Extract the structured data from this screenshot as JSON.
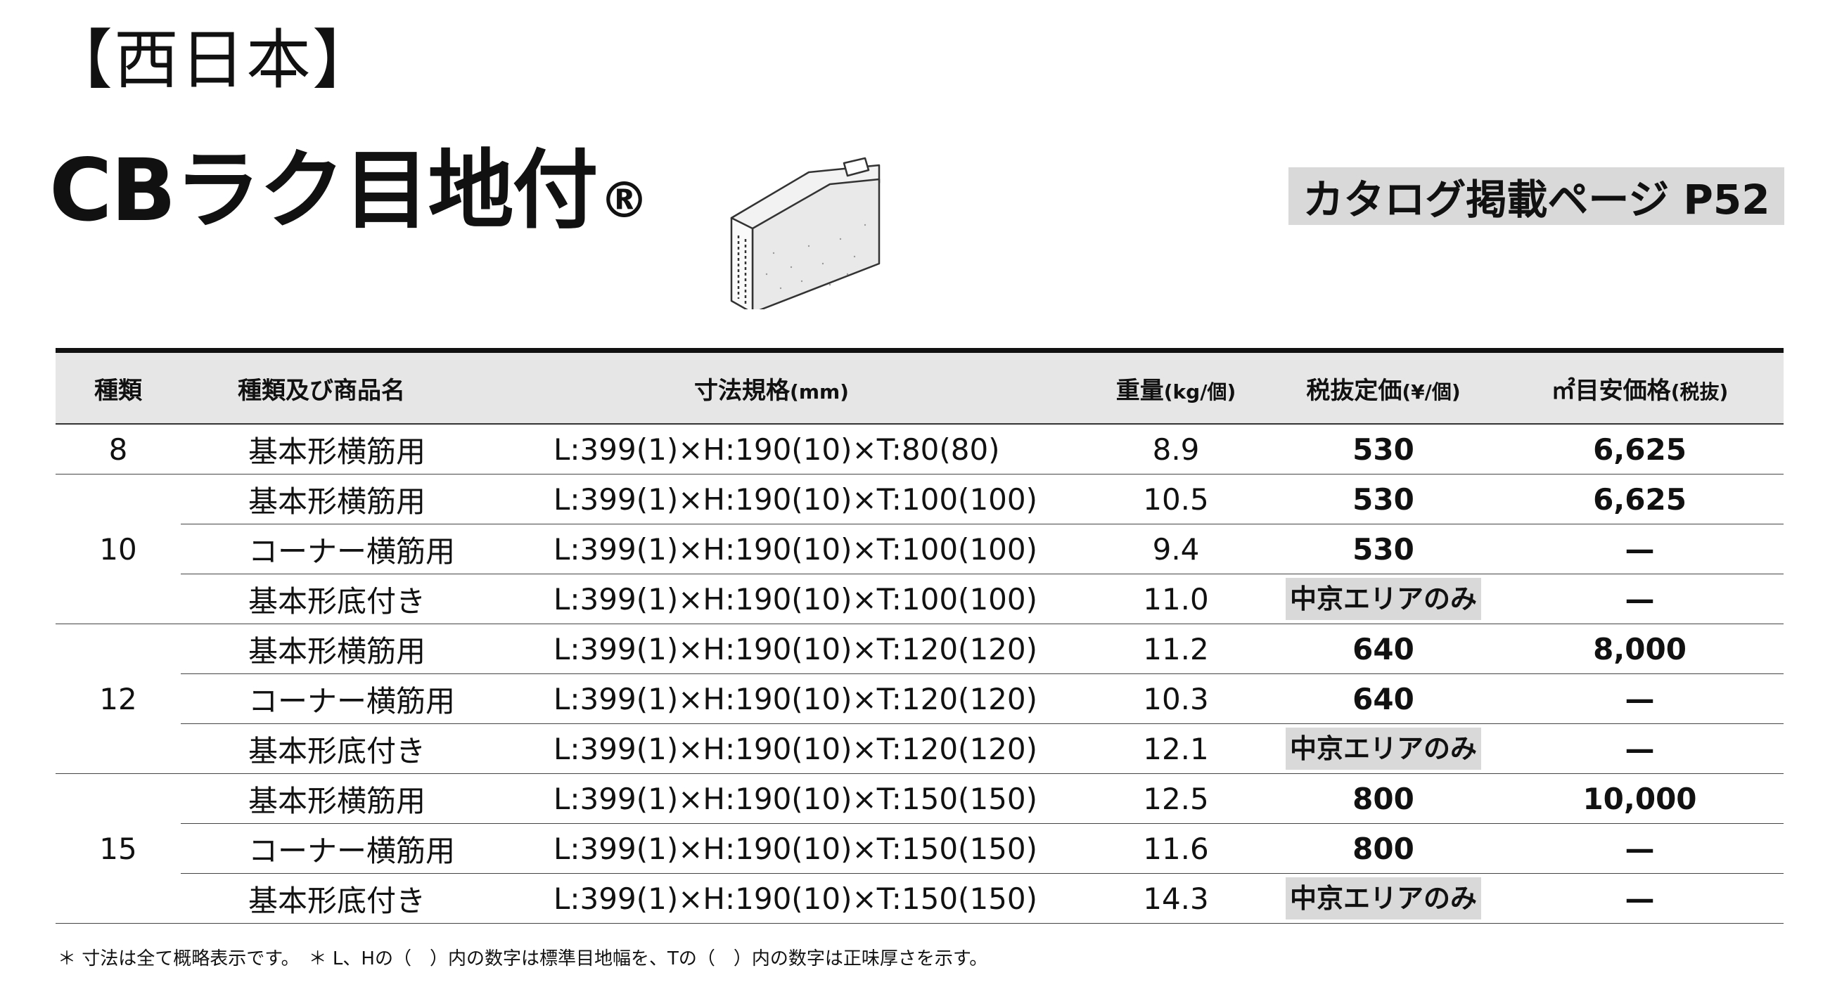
{
  "region": "【西日本】",
  "title": {
    "name": "CBラク目地付",
    "mark": "®"
  },
  "catalog": {
    "label": "カタログ掲載ページ P52"
  },
  "table": {
    "headers": {
      "kind": "種類",
      "product": "種類及び商品名",
      "dimensions": "寸法規格",
      "dimensions_unit": "(mm)",
      "weight": "重量",
      "weight_unit": "(kg/個)",
      "price": "税抜定価",
      "price_unit": "(¥/個)",
      "sqm_price": "㎡目安価格",
      "sqm_price_unit": "(税抜)"
    },
    "groups": [
      {
        "kind": "8",
        "rows": [
          {
            "name": "基本形横筋用",
            "dim": "L:399(1)×H:190(10)×T:80(80)",
            "weight": "8.9",
            "price": "530",
            "sqm": "6,625"
          }
        ]
      },
      {
        "kind": "10",
        "rows": [
          {
            "name": "基本形横筋用",
            "dim": "L:399(1)×H:190(10)×T:100(100)",
            "weight": "10.5",
            "price": "530",
            "sqm": "6,625"
          },
          {
            "name": "コーナー横筋用",
            "dim": "L:399(1)×H:190(10)×T:100(100)",
            "weight": "9.4",
            "price": "530",
            "sqm": "—"
          },
          {
            "name": "基本形底付き",
            "dim": "L:399(1)×H:190(10)×T:100(100)",
            "weight": "11.0",
            "price": "中京エリアのみ",
            "sqm": "—"
          }
        ]
      },
      {
        "kind": "12",
        "rows": [
          {
            "name": "基本形横筋用",
            "dim": "L:399(1)×H:190(10)×T:120(120)",
            "weight": "11.2",
            "price": "640",
            "sqm": "8,000"
          },
          {
            "name": "コーナー横筋用",
            "dim": "L:399(1)×H:190(10)×T:120(120)",
            "weight": "10.3",
            "price": "640",
            "sqm": "—"
          },
          {
            "name": "基本形底付き",
            "dim": "L:399(1)×H:190(10)×T:120(120)",
            "weight": "12.1",
            "price": "中京エリアのみ",
            "sqm": "—"
          }
        ]
      },
      {
        "kind": "15",
        "rows": [
          {
            "name": "基本形横筋用",
            "dim": "L:399(1)×H:190(10)×T:150(150)",
            "weight": "12.5",
            "price": "800",
            "sqm": "10,000"
          },
          {
            "name": "コーナー横筋用",
            "dim": "L:399(1)×H:190(10)×T:150(150)",
            "weight": "11.6",
            "price": "800",
            "sqm": "—"
          },
          {
            "name": "基本形底付き",
            "dim": "L:399(1)×H:190(10)×T:150(150)",
            "weight": "14.3",
            "price": "中京エリアのみ",
            "sqm": "—"
          }
        ]
      }
    ]
  },
  "footnote": "＊ 寸法は全て概略表示です。　＊ L、Hの（　）内の数字は標準目地幅を、Tの（　）内の数字は正味厚さを示す。"
}
